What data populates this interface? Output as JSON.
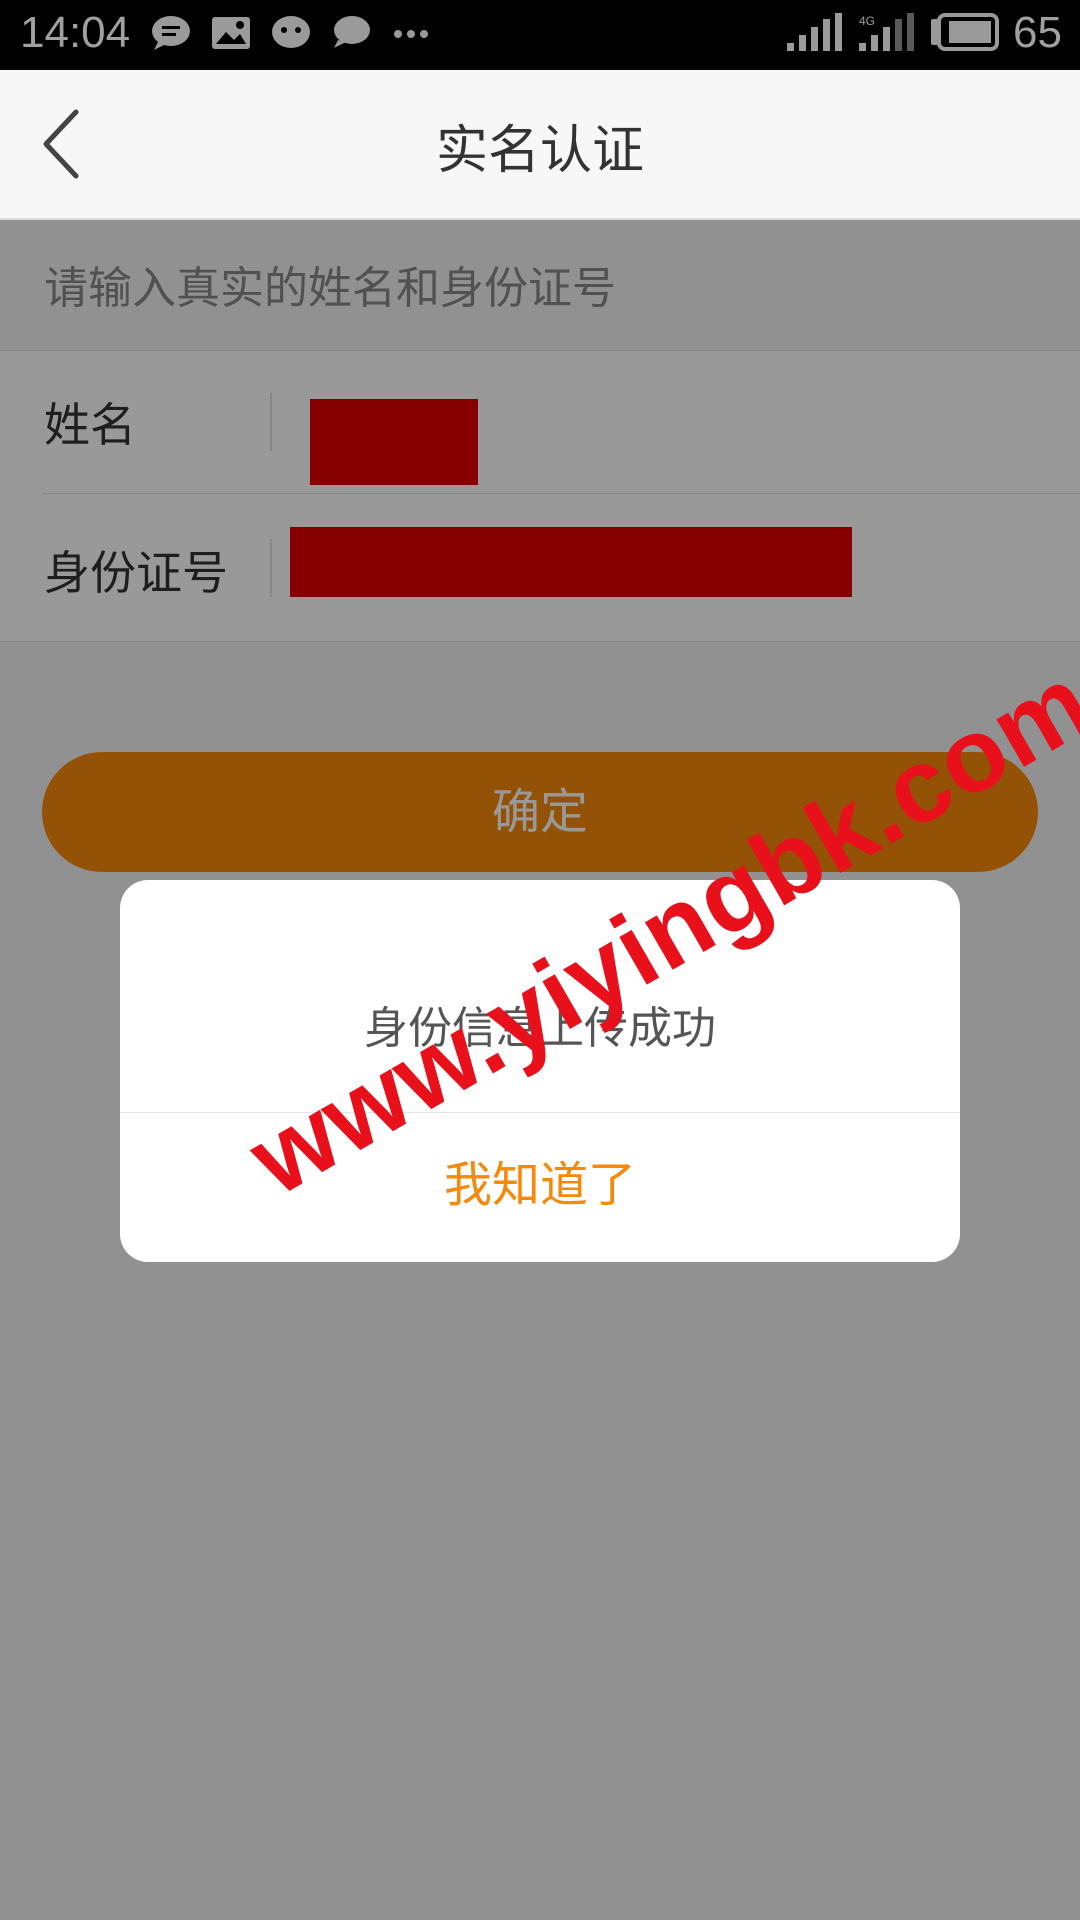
{
  "status_bar": {
    "time": "14:04",
    "battery": "65",
    "network_label": "4G",
    "icons": [
      "chat-bubble-icon",
      "image-icon",
      "wechat-icon",
      "message-icon",
      "more-dots-icon",
      "signal-icon",
      "signal-4g-icon",
      "battery-icon"
    ]
  },
  "header": {
    "title": "实名认证",
    "back_icon": "chevron-left-icon"
  },
  "form": {
    "hint": "请输入真实的姓名和身份证号",
    "name_label": "姓名",
    "id_label": "身份证号"
  },
  "confirm_button": {
    "label": "确定"
  },
  "dialog": {
    "message": "身份信息上传成功",
    "button_label": "我知道了"
  },
  "watermark": {
    "text": "www.yiyingbk.com"
  },
  "colors": {
    "accent": "#f5890b",
    "redaction": "#e00000",
    "watermark": "#e8101a"
  }
}
